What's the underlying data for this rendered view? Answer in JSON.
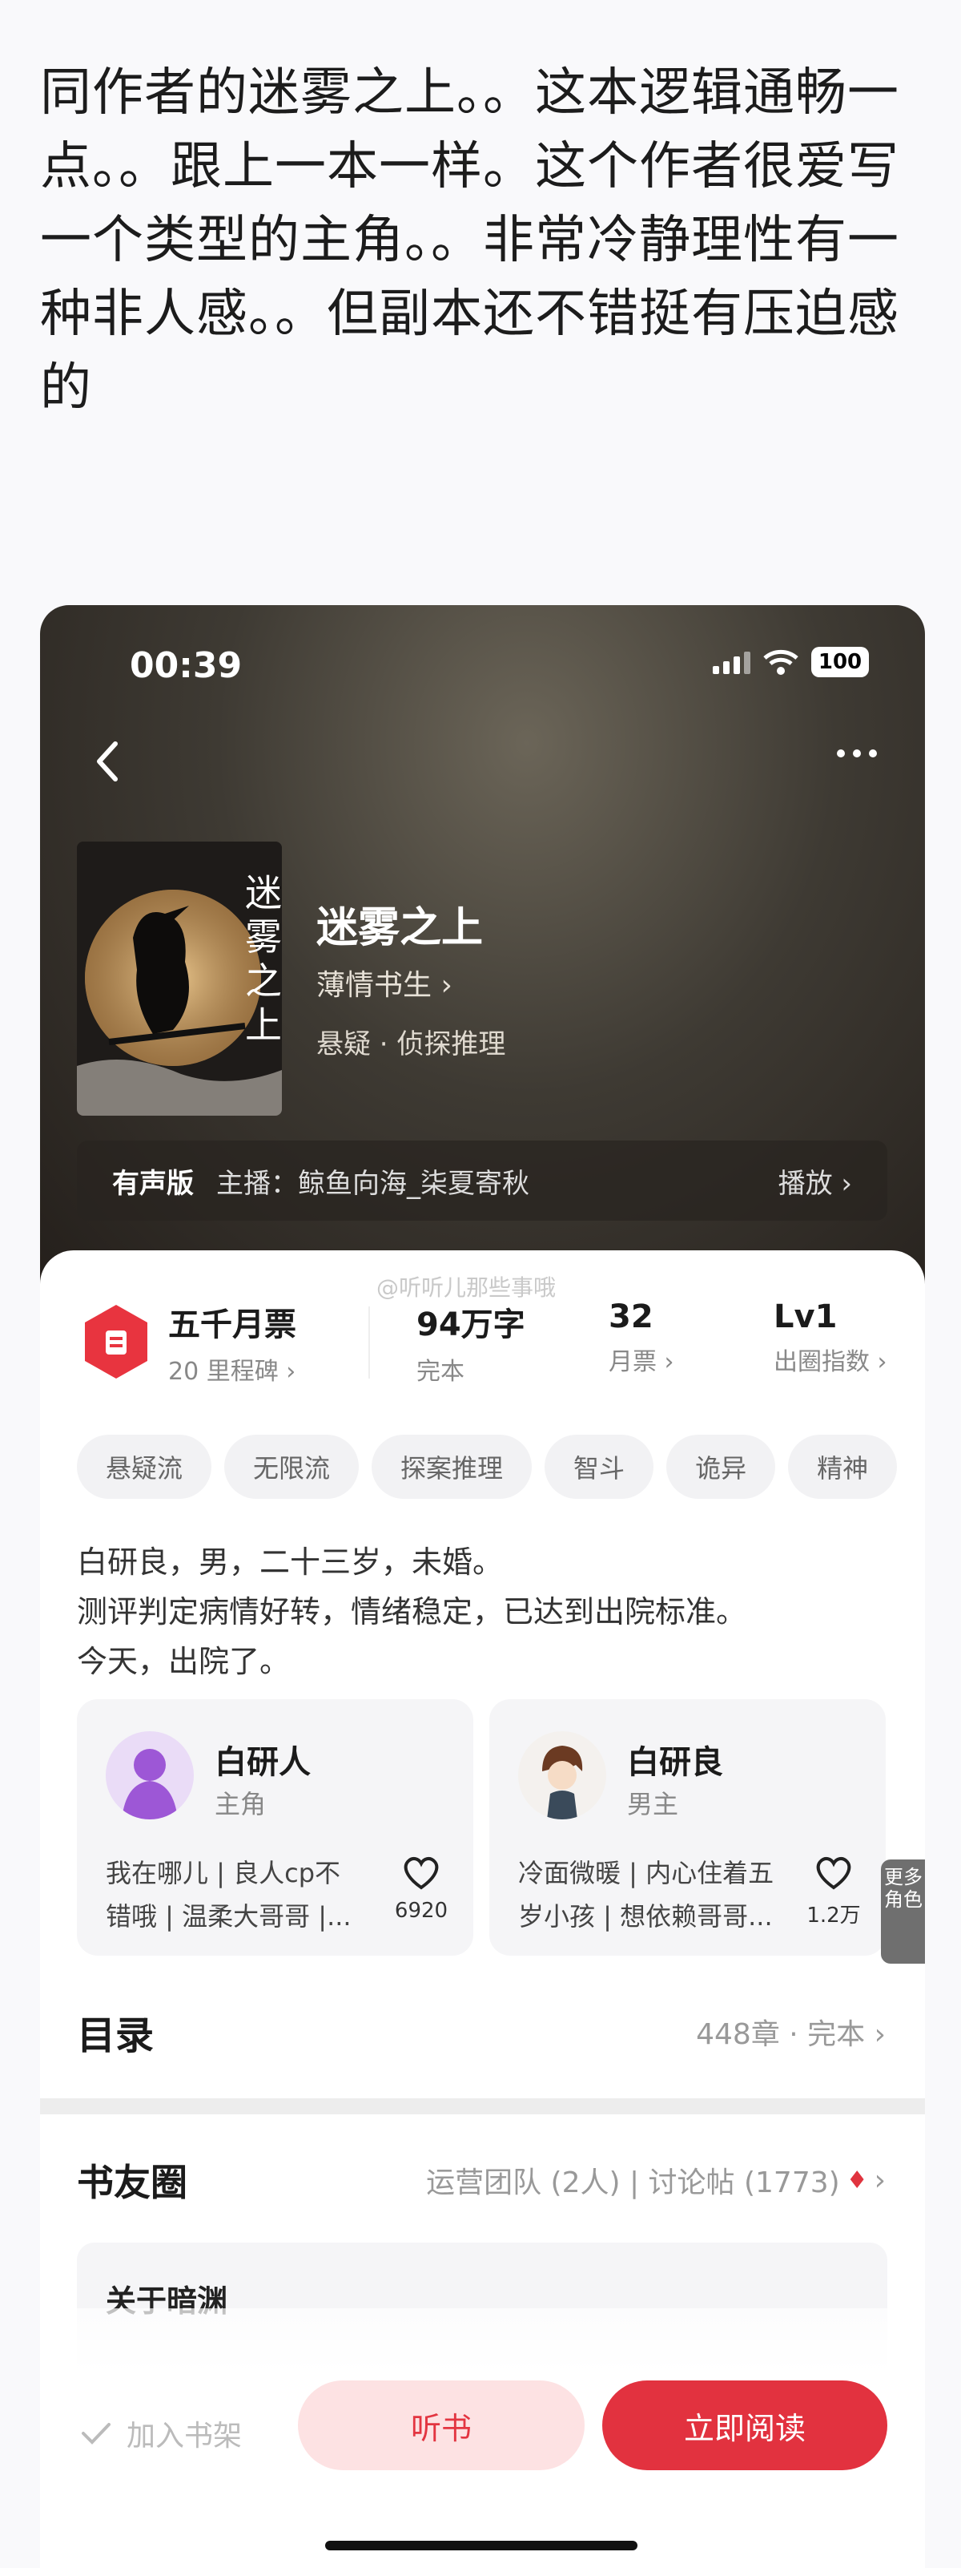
{
  "post": {
    "lines": [
      "同作者的迷雾之上。。这本逻辑通畅一",
      "点。。跟上一本一样。这个作者很爱写",
      "一个类型的主角。。非常冷静理性有一",
      "种非人感。。但副本还不错挺有压迫感",
      "的"
    ]
  },
  "status": {
    "time": "00:39",
    "battery": "100"
  },
  "book": {
    "title": "迷雾之上",
    "author": "薄情书生",
    "genre": "悬疑 · 侦探推理",
    "cover_text": "迷雾之上"
  },
  "audio": {
    "tag": "有声版",
    "host": "主播：鲸鱼向海_柒夏寄秋",
    "play": "播放"
  },
  "watermark": "@听听儿那些事哦",
  "stats": {
    "ticket": {
      "value": "五千月票",
      "label": "20 里程碑"
    },
    "words": {
      "value": "94万字",
      "label": "完本"
    },
    "votes": {
      "value": "32",
      "label": "月票"
    },
    "level": {
      "value": "Lv1",
      "label": "出圈指数"
    }
  },
  "tags": [
    "悬疑流",
    "无限流",
    "探案推理",
    "智斗",
    "诡异",
    "精神"
  ],
  "blurb": [
    "白研良，男，二十三岁，未婚。",
    "测评判定病情好转，情绪稳定，已达到出院标准。",
    "今天，出院了。"
  ],
  "characters": [
    {
      "name": "白研人",
      "role": "主角",
      "desc1": "我在哪儿 | 良人cp不",
      "desc2": "错哦 | 温柔大哥哥 |...",
      "likes": "6920"
    },
    {
      "name": "白研良",
      "role": "男主",
      "desc1": "冷面微暖 | 内心住着五",
      "desc2": "岁小孩 | 想依赖哥哥...",
      "likes": "1.2万"
    }
  ],
  "more_roles": "更多角色",
  "toc": {
    "title": "目录",
    "info": "448章 · 完本"
  },
  "circle": {
    "title": "书友圈",
    "info": "运营团队 (2人) | 讨论帖 (1773)"
  },
  "post_card": {
    "title": "关于暗渊"
  },
  "actions": {
    "shelf": "加入书架",
    "listen": "听书",
    "read": "立即阅读"
  },
  "colors": {
    "accent": "#e2323f",
    "accent_light": "#fde2e3"
  }
}
